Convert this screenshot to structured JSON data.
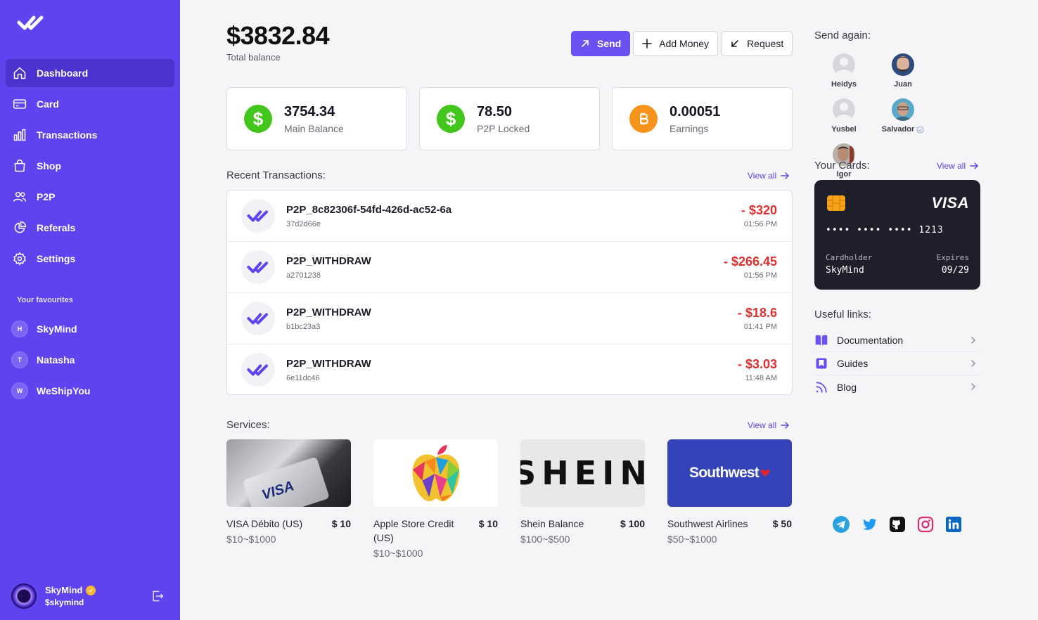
{
  "sidebar": {
    "nav": [
      {
        "label": "Dashboard",
        "icon": "home-icon",
        "active": true
      },
      {
        "label": "Card",
        "icon": "credit-card-icon"
      },
      {
        "label": "Transactions",
        "icon": "bar-chart-icon"
      },
      {
        "label": "Shop",
        "icon": "shopping-bag-icon"
      },
      {
        "label": "P2P",
        "icon": "users-icon"
      },
      {
        "label": "Referals",
        "icon": "pie-chart-icon"
      },
      {
        "label": "Settings",
        "icon": "gear-icon"
      }
    ],
    "favourites_title": "Your favourites",
    "favourites": [
      {
        "initial": "H",
        "label": "SkyMind"
      },
      {
        "initial": "T",
        "label": "Natasha"
      },
      {
        "initial": "W",
        "label": "WeShipYou"
      }
    ],
    "user": {
      "name": "SkyMind",
      "handle": "$skymind"
    }
  },
  "header": {
    "balance": "$3832.84",
    "balance_label": "Total balance",
    "actions": {
      "send": "Send",
      "add_money": "Add Money",
      "request": "Request"
    }
  },
  "stats": [
    {
      "value": "3754.34",
      "label": "Main Balance",
      "icon": "dollar-icon",
      "color": "#43c61b"
    },
    {
      "value": "78.50",
      "label": "P2P Locked",
      "icon": "dollar-icon",
      "color": "#43c61b"
    },
    {
      "value": "0.00051",
      "label": "Earnings",
      "icon": "bitcoin-icon",
      "color": "#f7931a"
    }
  ],
  "transactions": {
    "title": "Recent Transactions:",
    "view_all": "View all",
    "items": [
      {
        "name": "P2P_8c82306f-54fd-426d-ac52-6a",
        "id": "37d2d66e",
        "amount": "- $320",
        "time": "01:56 PM"
      },
      {
        "name": "P2P_WITHDRAW",
        "id": "a2701238",
        "amount": "- $266.45",
        "time": "01:56 PM"
      },
      {
        "name": "P2P_WITHDRAW",
        "id": "b1bc23a3",
        "amount": "- $18.6",
        "time": "01:41 PM"
      },
      {
        "name": "P2P_WITHDRAW",
        "id": "6e11dc46",
        "amount": "- $3.03",
        "time": "11:48 AM"
      }
    ]
  },
  "services": {
    "title": "Services:",
    "view_all": "View all",
    "items": [
      {
        "name": "VISA Débito (US)",
        "price": "$ 10",
        "range": "$10~$1000",
        "image_text": "VISA"
      },
      {
        "name": "Apple Store Credit (US)",
        "price": "$ 10",
        "range": "$10~$1000",
        "image_text": ""
      },
      {
        "name": "Shein Balance",
        "price": "$ 100",
        "range": "$100~$500",
        "image_text": "SHEIN"
      },
      {
        "name": "Southwest Airlines",
        "price": "$ 50",
        "range": "$50~$1000",
        "image_text": "Southwest"
      }
    ]
  },
  "send_again": {
    "title": "Send again:",
    "contacts": [
      {
        "name": "Heidys"
      },
      {
        "name": "Juan"
      },
      {
        "name": "Yusbel"
      },
      {
        "name": "Salvador",
        "verified": true
      },
      {
        "name": "Igor"
      }
    ]
  },
  "cards": {
    "title": "Your Cards:",
    "view_all": "View all",
    "card": {
      "brand": "VISA",
      "number": "•••• •••• •••• 1213",
      "holder_label": "Cardholder",
      "holder": "SkyMind",
      "expires_label": "Expires",
      "expires": "09/29"
    }
  },
  "useful_links": {
    "title": "Useful links:",
    "items": [
      {
        "label": "Documentation",
        "icon": "book-icon"
      },
      {
        "label": "Guides",
        "icon": "bookmark-icon"
      },
      {
        "label": "Blog",
        "icon": "rss-icon"
      }
    ]
  },
  "socials": [
    "telegram-icon",
    "twitter-icon",
    "github-icon",
    "instagram-icon",
    "linkedin-icon"
  ],
  "colors": {
    "sidebar": "#5e43ef",
    "accent": "#6a52f2",
    "negative": "#e02f2f"
  }
}
